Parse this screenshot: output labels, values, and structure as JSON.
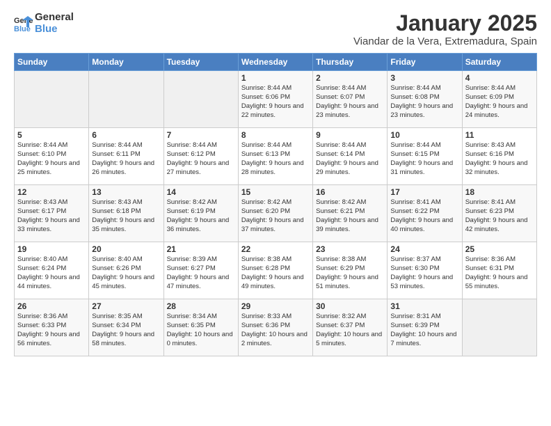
{
  "logo": {
    "line1": "General",
    "line2": "Blue"
  },
  "title": "January 2025",
  "subtitle": "Viandar de la Vera, Extremadura, Spain",
  "headers": [
    "Sunday",
    "Monday",
    "Tuesday",
    "Wednesday",
    "Thursday",
    "Friday",
    "Saturday"
  ],
  "weeks": [
    [
      {
        "day": "",
        "info": ""
      },
      {
        "day": "",
        "info": ""
      },
      {
        "day": "",
        "info": ""
      },
      {
        "day": "1",
        "info": "Sunrise: 8:44 AM\nSunset: 6:06 PM\nDaylight: 9 hours\nand 22 minutes."
      },
      {
        "day": "2",
        "info": "Sunrise: 8:44 AM\nSunset: 6:07 PM\nDaylight: 9 hours\nand 23 minutes."
      },
      {
        "day": "3",
        "info": "Sunrise: 8:44 AM\nSunset: 6:08 PM\nDaylight: 9 hours\nand 23 minutes."
      },
      {
        "day": "4",
        "info": "Sunrise: 8:44 AM\nSunset: 6:09 PM\nDaylight: 9 hours\nand 24 minutes."
      }
    ],
    [
      {
        "day": "5",
        "info": "Sunrise: 8:44 AM\nSunset: 6:10 PM\nDaylight: 9 hours\nand 25 minutes."
      },
      {
        "day": "6",
        "info": "Sunrise: 8:44 AM\nSunset: 6:11 PM\nDaylight: 9 hours\nand 26 minutes."
      },
      {
        "day": "7",
        "info": "Sunrise: 8:44 AM\nSunset: 6:12 PM\nDaylight: 9 hours\nand 27 minutes."
      },
      {
        "day": "8",
        "info": "Sunrise: 8:44 AM\nSunset: 6:13 PM\nDaylight: 9 hours\nand 28 minutes."
      },
      {
        "day": "9",
        "info": "Sunrise: 8:44 AM\nSunset: 6:14 PM\nDaylight: 9 hours\nand 29 minutes."
      },
      {
        "day": "10",
        "info": "Sunrise: 8:44 AM\nSunset: 6:15 PM\nDaylight: 9 hours\nand 31 minutes."
      },
      {
        "day": "11",
        "info": "Sunrise: 8:43 AM\nSunset: 6:16 PM\nDaylight: 9 hours\nand 32 minutes."
      }
    ],
    [
      {
        "day": "12",
        "info": "Sunrise: 8:43 AM\nSunset: 6:17 PM\nDaylight: 9 hours\nand 33 minutes."
      },
      {
        "day": "13",
        "info": "Sunrise: 8:43 AM\nSunset: 6:18 PM\nDaylight: 9 hours\nand 35 minutes."
      },
      {
        "day": "14",
        "info": "Sunrise: 8:42 AM\nSunset: 6:19 PM\nDaylight: 9 hours\nand 36 minutes."
      },
      {
        "day": "15",
        "info": "Sunrise: 8:42 AM\nSunset: 6:20 PM\nDaylight: 9 hours\nand 37 minutes."
      },
      {
        "day": "16",
        "info": "Sunrise: 8:42 AM\nSunset: 6:21 PM\nDaylight: 9 hours\nand 39 minutes."
      },
      {
        "day": "17",
        "info": "Sunrise: 8:41 AM\nSunset: 6:22 PM\nDaylight: 9 hours\nand 40 minutes."
      },
      {
        "day": "18",
        "info": "Sunrise: 8:41 AM\nSunset: 6:23 PM\nDaylight: 9 hours\nand 42 minutes."
      }
    ],
    [
      {
        "day": "19",
        "info": "Sunrise: 8:40 AM\nSunset: 6:24 PM\nDaylight: 9 hours\nand 44 minutes."
      },
      {
        "day": "20",
        "info": "Sunrise: 8:40 AM\nSunset: 6:26 PM\nDaylight: 9 hours\nand 45 minutes."
      },
      {
        "day": "21",
        "info": "Sunrise: 8:39 AM\nSunset: 6:27 PM\nDaylight: 9 hours\nand 47 minutes."
      },
      {
        "day": "22",
        "info": "Sunrise: 8:38 AM\nSunset: 6:28 PM\nDaylight: 9 hours\nand 49 minutes."
      },
      {
        "day": "23",
        "info": "Sunrise: 8:38 AM\nSunset: 6:29 PM\nDaylight: 9 hours\nand 51 minutes."
      },
      {
        "day": "24",
        "info": "Sunrise: 8:37 AM\nSunset: 6:30 PM\nDaylight: 9 hours\nand 53 minutes."
      },
      {
        "day": "25",
        "info": "Sunrise: 8:36 AM\nSunset: 6:31 PM\nDaylight: 9 hours\nand 55 minutes."
      }
    ],
    [
      {
        "day": "26",
        "info": "Sunrise: 8:36 AM\nSunset: 6:33 PM\nDaylight: 9 hours\nand 56 minutes."
      },
      {
        "day": "27",
        "info": "Sunrise: 8:35 AM\nSunset: 6:34 PM\nDaylight: 9 hours\nand 58 minutes."
      },
      {
        "day": "28",
        "info": "Sunrise: 8:34 AM\nSunset: 6:35 PM\nDaylight: 10 hours\nand 0 minutes."
      },
      {
        "day": "29",
        "info": "Sunrise: 8:33 AM\nSunset: 6:36 PM\nDaylight: 10 hours\nand 2 minutes."
      },
      {
        "day": "30",
        "info": "Sunrise: 8:32 AM\nSunset: 6:37 PM\nDaylight: 10 hours\nand 5 minutes."
      },
      {
        "day": "31",
        "info": "Sunrise: 8:31 AM\nSunset: 6:39 PM\nDaylight: 10 hours\nand 7 minutes."
      },
      {
        "day": "",
        "info": ""
      }
    ]
  ]
}
